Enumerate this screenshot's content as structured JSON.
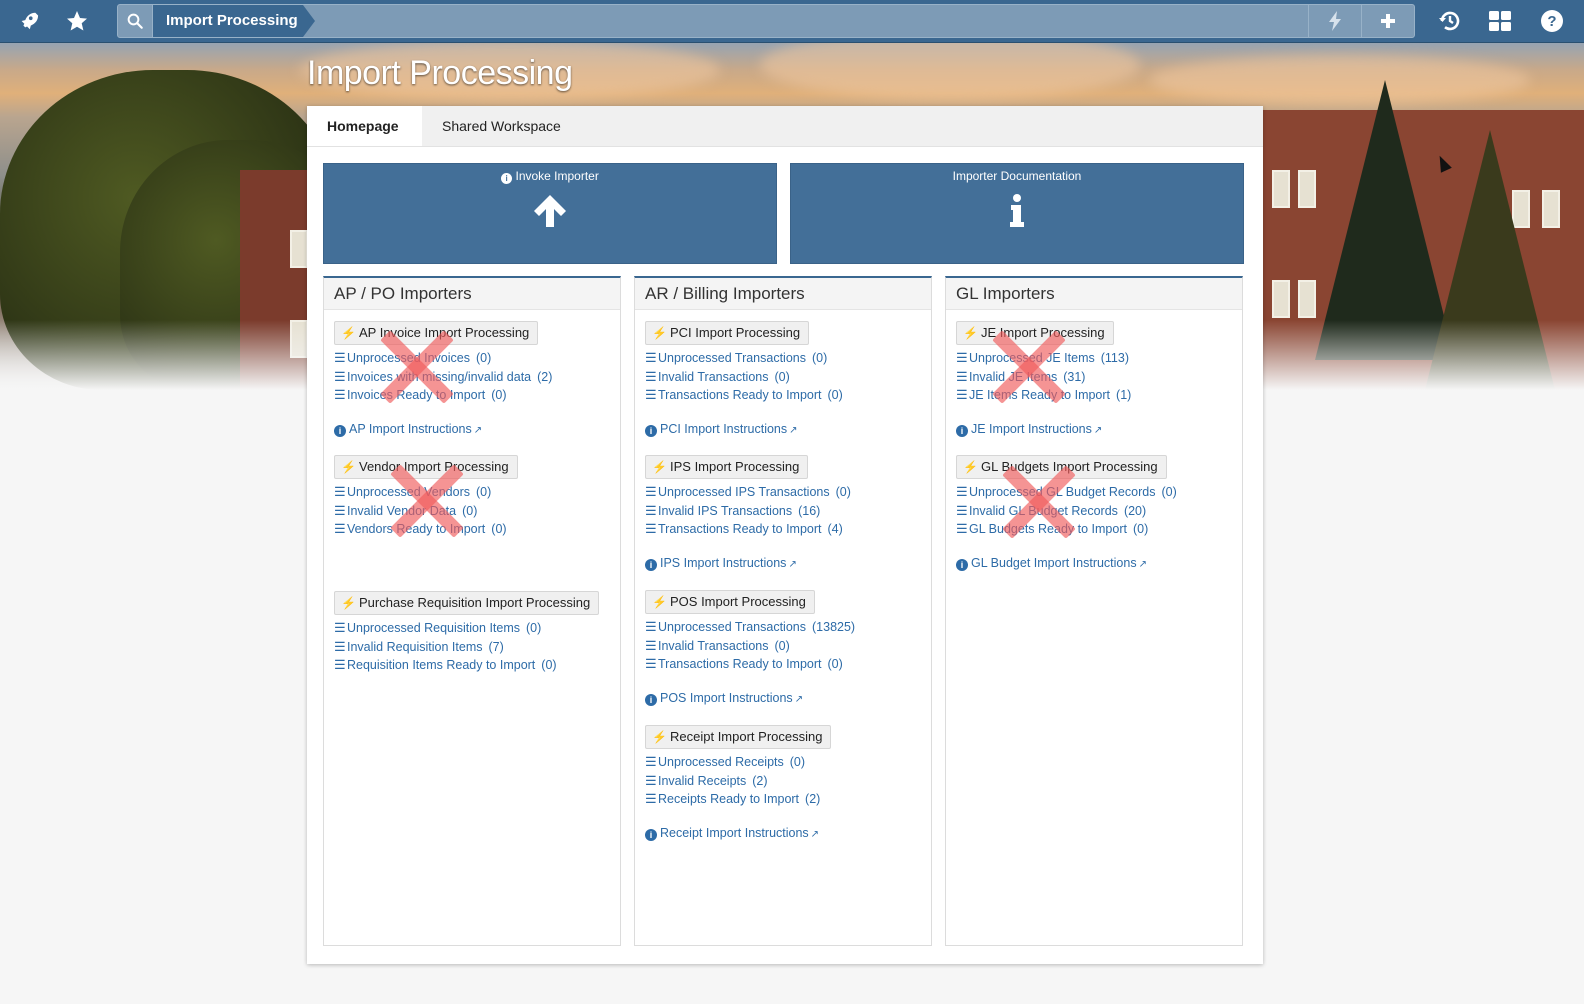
{
  "topbar": {
    "left_icons": [
      "rocket-icon",
      "star-icon"
    ],
    "search_icon": "search-icon",
    "breadcrumb": "Import Processing",
    "quick_icons": [
      "bolt-icon",
      "plus-icon"
    ],
    "right_icons": [
      "history-icon",
      "grid-icon",
      "help-icon"
    ]
  },
  "page": {
    "title": "Import Processing"
  },
  "tabs": [
    {
      "label": "Homepage",
      "active": true
    },
    {
      "label": "Shared Workspace",
      "active": false
    }
  ],
  "actions": [
    {
      "label": "Invoke Importer",
      "icon": "arrow-up-icon"
    },
    {
      "label": "Importer Documentation",
      "icon": "info-icon"
    }
  ],
  "columns": [
    {
      "title": "AP / PO Importers",
      "groups": [
        {
          "title": "AP Invoice Import Processing",
          "links": [
            {
              "label": "Unprocessed Invoices",
              "count": "(0)"
            },
            {
              "label": "Invoices with missing/invalid data",
              "count": "(2)"
            },
            {
              "label": "Invoices Ready to Import",
              "count": "(0)"
            }
          ],
          "instructions": "AP Import Instructions"
        },
        {
          "title": "Vendor Import Processing",
          "links": [
            {
              "label": "Unprocessed Vendors",
              "count": "(0)"
            },
            {
              "label": "Invalid Vendor Data",
              "count": "(0)"
            },
            {
              "label": "Vendors Ready to Import",
              "count": "(0)"
            }
          ]
        },
        {
          "title": "Purchase Requisition Import Processing",
          "links": [
            {
              "label": "Unprocessed Requisition Items",
              "count": "(0)"
            },
            {
              "label": "Invalid Requisition Items",
              "count": "(7)"
            },
            {
              "label": "Requisition Items Ready to Import",
              "count": "(0)"
            }
          ]
        }
      ]
    },
    {
      "title": "AR / Billing Importers",
      "groups": [
        {
          "title": "PCI Import Processing",
          "links": [
            {
              "label": "Unprocessed Transactions",
              "count": "(0)"
            },
            {
              "label": "Invalid Transactions",
              "count": "(0)"
            },
            {
              "label": "Transactions Ready to Import",
              "count": "(0)"
            }
          ],
          "instructions": "PCI Import Instructions"
        },
        {
          "title": "IPS Import Processing",
          "links": [
            {
              "label": "Unprocessed IPS Transactions",
              "count": "(0)"
            },
            {
              "label": "Invalid IPS Transactions",
              "count": "(16)"
            },
            {
              "label": "Transactions Ready to Import",
              "count": "(4)"
            }
          ],
          "instructions": "IPS Import Instructions"
        },
        {
          "title": "POS Import Processing",
          "links": [
            {
              "label": "Unprocessed Transactions",
              "count": "(13825)"
            },
            {
              "label": "Invalid Transactions",
              "count": "(0)"
            },
            {
              "label": "Transactions Ready to Import",
              "count": "(0)"
            }
          ],
          "instructions": "POS Import Instructions"
        },
        {
          "title": "Receipt Import Processing",
          "links": [
            {
              "label": "Unprocessed Receipts",
              "count": "(0)"
            },
            {
              "label": "Invalid Receipts",
              "count": "(2)"
            },
            {
              "label": "Receipts Ready to Import",
              "count": "(2)"
            }
          ],
          "instructions": "Receipt Import Instructions"
        }
      ]
    },
    {
      "title": "GL Importers",
      "groups": [
        {
          "title": "JE Import Processing",
          "links": [
            {
              "label": "Unprocessed JE Items",
              "count": "(113)"
            },
            {
              "label": "Invalid JE Items",
              "count": "(31)"
            },
            {
              "label": "JE Items Ready to Import",
              "count": "(1)"
            }
          ],
          "instructions": "JE Import Instructions"
        },
        {
          "title": "GL Budgets Import Processing",
          "links": [
            {
              "label": "Unprocessed GL Budget Records",
              "count": "(0)"
            },
            {
              "label": "Invalid GL Budget Records",
              "count": "(20)"
            },
            {
              "label": "GL Budgets Ready to Import",
              "count": "(0)"
            }
          ],
          "instructions": "GL Budget Import Instructions"
        }
      ]
    }
  ],
  "colors": {
    "topbar": "#3a6790",
    "accent": "#436f98",
    "link": "#2d6ba7",
    "x_mark": "#ef5a5a"
  }
}
